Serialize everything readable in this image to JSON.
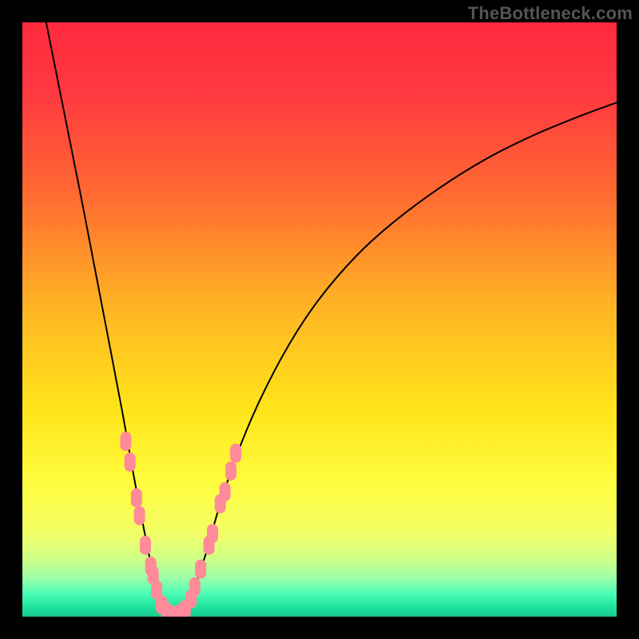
{
  "watermark": "TheBottleneck.com",
  "chart_data": {
    "type": "line",
    "title": "",
    "xlabel": "",
    "ylabel": "",
    "xlim": [
      0,
      100
    ],
    "ylim": [
      0,
      100
    ],
    "background_gradient_stops": [
      {
        "offset": 0.0,
        "color": "#ff2a3d"
      },
      {
        "offset": 0.12,
        "color": "#ff3940"
      },
      {
        "offset": 0.29,
        "color": "#ff6a31"
      },
      {
        "offset": 0.48,
        "color": "#ffb524"
      },
      {
        "offset": 0.65,
        "color": "#ffe41a"
      },
      {
        "offset": 0.78,
        "color": "#fffd40"
      },
      {
        "offset": 0.86,
        "color": "#f3ff66"
      },
      {
        "offset": 0.905,
        "color": "#ccff88"
      },
      {
        "offset": 0.935,
        "color": "#9cffa8"
      },
      {
        "offset": 0.96,
        "color": "#4fffb6"
      },
      {
        "offset": 0.985,
        "color": "#1ce29c"
      },
      {
        "offset": 1.0,
        "color": "#17c98c"
      }
    ],
    "series": [
      {
        "name": "bottleneck-curve",
        "stroke": "#000000",
        "stroke_width": 2,
        "points": [
          {
            "x": 4.0,
            "y": 100.0
          },
          {
            "x": 6.0,
            "y": 90.0
          },
          {
            "x": 8.0,
            "y": 80.0
          },
          {
            "x": 10.0,
            "y": 70.0
          },
          {
            "x": 12.5,
            "y": 57.0
          },
          {
            "x": 15.0,
            "y": 44.0
          },
          {
            "x": 17.0,
            "y": 33.5
          },
          {
            "x": 18.5,
            "y": 25.0
          },
          {
            "x": 19.8,
            "y": 18.0
          },
          {
            "x": 21.0,
            "y": 12.0
          },
          {
            "x": 22.0,
            "y": 7.0
          },
          {
            "x": 23.0,
            "y": 3.2
          },
          {
            "x": 24.0,
            "y": 1.0
          },
          {
            "x": 25.0,
            "y": 0.0
          },
          {
            "x": 26.0,
            "y": 0.0
          },
          {
            "x": 27.3,
            "y": 1.2
          },
          {
            "x": 29.0,
            "y": 5.0
          },
          {
            "x": 31.0,
            "y": 11.0
          },
          {
            "x": 33.0,
            "y": 18.0
          },
          {
            "x": 36.0,
            "y": 27.0
          },
          {
            "x": 40.0,
            "y": 36.5
          },
          {
            "x": 45.0,
            "y": 46.0
          },
          {
            "x": 50.0,
            "y": 53.5
          },
          {
            "x": 56.0,
            "y": 60.5
          },
          {
            "x": 62.0,
            "y": 66.0
          },
          {
            "x": 70.0,
            "y": 72.0
          },
          {
            "x": 78.0,
            "y": 77.0
          },
          {
            "x": 86.0,
            "y": 81.0
          },
          {
            "x": 94.0,
            "y": 84.3
          },
          {
            "x": 100.0,
            "y": 86.5
          }
        ]
      },
      {
        "name": "marker-cluster-left",
        "type": "scatter",
        "fill": "#ff8a99",
        "stroke": "#ff8a99",
        "marker_width": 14,
        "marker_height": 24,
        "marker_rx": 7,
        "points": [
          {
            "x": 17.4,
            "y": 29.5
          },
          {
            "x": 18.1,
            "y": 26.0
          },
          {
            "x": 19.2,
            "y": 20.0
          },
          {
            "x": 19.7,
            "y": 17.0
          },
          {
            "x": 20.7,
            "y": 12.0
          },
          {
            "x": 21.6,
            "y": 8.5
          },
          {
            "x": 22.0,
            "y": 7.0
          },
          {
            "x": 22.6,
            "y": 4.5
          }
        ]
      },
      {
        "name": "marker-cluster-right",
        "type": "scatter",
        "fill": "#ff8a99",
        "stroke": "#ff8a99",
        "marker_width": 14,
        "marker_height": 24,
        "marker_rx": 7,
        "points": [
          {
            "x": 28.4,
            "y": 3.0
          },
          {
            "x": 29.0,
            "y": 5.0
          },
          {
            "x": 30.0,
            "y": 8.0
          },
          {
            "x": 31.4,
            "y": 12.0
          },
          {
            "x": 32.0,
            "y": 14.0
          },
          {
            "x": 33.3,
            "y": 19.0
          },
          {
            "x": 34.1,
            "y": 21.0
          },
          {
            "x": 35.1,
            "y": 24.5
          },
          {
            "x": 35.9,
            "y": 27.5
          }
        ]
      },
      {
        "name": "marker-cluster-bottom",
        "type": "scatter",
        "fill": "#ff8a99",
        "stroke": "#ff8a99",
        "marker_width": 14,
        "marker_height": 24,
        "marker_rx": 7,
        "points": [
          {
            "x": 23.4,
            "y": 2.0
          },
          {
            "x": 24.3,
            "y": 0.8
          },
          {
            "x": 25.3,
            "y": 0.2
          },
          {
            "x": 26.5,
            "y": 0.5
          },
          {
            "x": 27.4,
            "y": 1.2
          }
        ]
      }
    ]
  }
}
